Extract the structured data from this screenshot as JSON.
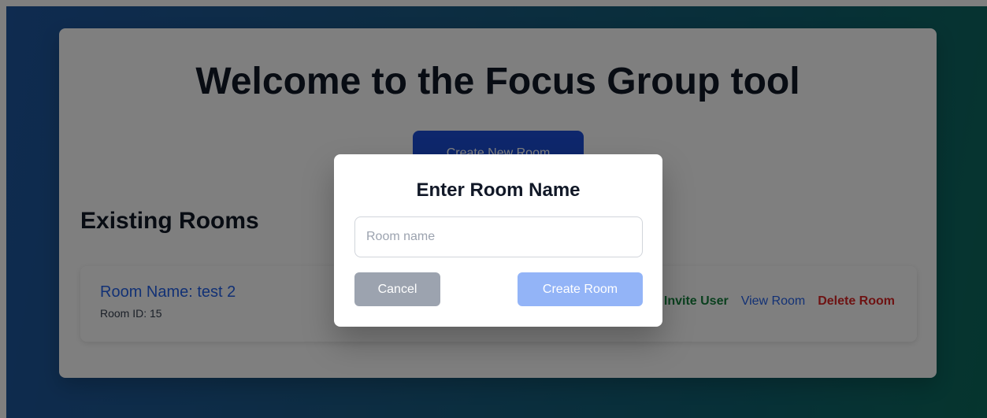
{
  "page": {
    "title": "Welcome to the Focus Group tool",
    "create_new_room_label": "Create New Room"
  },
  "rooms_section": {
    "title": "Existing Rooms",
    "rooms": [
      {
        "name": "Room Name: test 2",
        "id": "Room ID: 15",
        "actions": {
          "invite_label": "Invite User",
          "view_label": "View Room",
          "delete_label": "Delete Room"
        }
      }
    ]
  },
  "modal": {
    "title": "Enter Room Name",
    "input_value": "",
    "input_placeholder": "Room name",
    "cancel_label": "Cancel",
    "create_label": "Create Room"
  },
  "colors": {
    "primary": "#1d4ed8",
    "link": "#2563eb",
    "invite": "#15803d",
    "delete": "#dc2626",
    "cancel": "#9ca3af",
    "create_disabled": "#93b4f7"
  }
}
